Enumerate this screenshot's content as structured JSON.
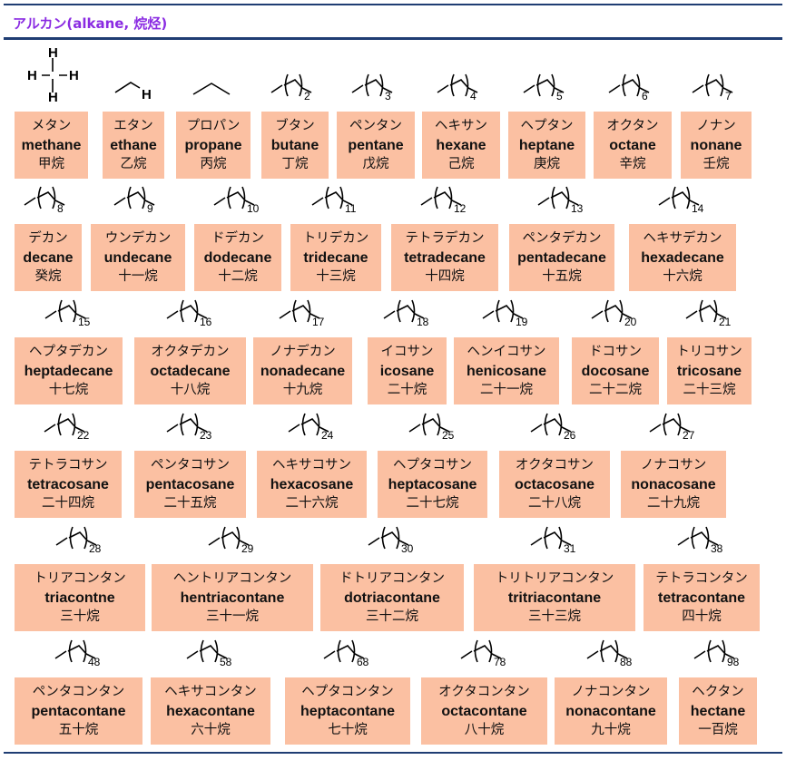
{
  "title": "アルカン(alkane, 烷烃)",
  "colors": {
    "title": "#8a2be2",
    "rule": "#1f3d73",
    "card": "#fbc0a2"
  },
  "alkanes": [
    {
      "kana": "メタン",
      "en": "methane",
      "kanji": "甲烷",
      "n": ""
    },
    {
      "kana": "エタン",
      "en": "ethane",
      "kanji": "乙烷",
      "n": ""
    },
    {
      "kana": "プロパン",
      "en": "propane",
      "kanji": "丙烷",
      "n": ""
    },
    {
      "kana": "ブタン",
      "en": "butane",
      "kanji": "丁烷",
      "n": "2"
    },
    {
      "kana": "ペンタン",
      "en": "pentane",
      "kanji": "戊烷",
      "n": "3"
    },
    {
      "kana": "ヘキサン",
      "en": "hexane",
      "kanji": "己烷",
      "n": "4"
    },
    {
      "kana": "ヘプタン",
      "en": "heptane",
      "kanji": "庚烷",
      "n": "5"
    },
    {
      "kana": "オクタン",
      "en": "octane",
      "kanji": "辛烷",
      "n": "6"
    },
    {
      "kana": "ノナン",
      "en": "nonane",
      "kanji": "壬烷",
      "n": "7"
    },
    {
      "kana": "デカン",
      "en": "decane",
      "kanji": "癸烷",
      "n": "8"
    },
    {
      "kana": "ウンデカン",
      "en": "undecane",
      "kanji": "十一烷",
      "n": "9"
    },
    {
      "kana": "ドデカン",
      "en": "dodecane",
      "kanji": "十二烷",
      "n": "10"
    },
    {
      "kana": "トリデカン",
      "en": "tridecane",
      "kanji": "十三烷",
      "n": "11"
    },
    {
      "kana": "テトラデカン",
      "en": "tetradecane",
      "kanji": "十四烷",
      "n": "12"
    },
    {
      "kana": "ペンタデカン",
      "en": "pentadecane",
      "kanji": "十五烷",
      "n": "13"
    },
    {
      "kana": "ヘキサデカン",
      "en": "hexadecane",
      "kanji": "十六烷",
      "n": "14"
    },
    {
      "kana": "ヘプタデカン",
      "en": "heptadecane",
      "kanji": "十七烷",
      "n": "15"
    },
    {
      "kana": "オクタデカン",
      "en": "octadecane",
      "kanji": "十八烷",
      "n": "16"
    },
    {
      "kana": "ノナデカン",
      "en": "nonadecane",
      "kanji": "十九烷",
      "n": "17"
    },
    {
      "kana": "イコサン",
      "en": "icosane",
      "kanji": "二十烷",
      "n": "18"
    },
    {
      "kana": "ヘンイコサン",
      "en": "henicosane",
      "kanji": "二十一烷",
      "n": "19"
    },
    {
      "kana": "ドコサン",
      "en": "docosane",
      "kanji": "二十二烷",
      "n": "20"
    },
    {
      "kana": "トリコサン",
      "en": "tricosane",
      "kanji": "二十三烷",
      "n": "21"
    },
    {
      "kana": "テトラコサン",
      "en": "tetracosane",
      "kanji": "二十四烷",
      "n": "22"
    },
    {
      "kana": "ペンタコサン",
      "en": "pentacosane",
      "kanji": "二十五烷",
      "n": "23"
    },
    {
      "kana": "ヘキサコサン",
      "en": "hexacosane",
      "kanji": "二十六烷",
      "n": "24"
    },
    {
      "kana": "ヘプタコサン",
      "en": "heptacosane",
      "kanji": "二十七烷",
      "n": "25"
    },
    {
      "kana": "オクタコサン",
      "en": "octacosane",
      "kanji": "二十八烷",
      "n": "26"
    },
    {
      "kana": "ノナコサン",
      "en": "nonacosane",
      "kanji": "二十九烷",
      "n": "27"
    },
    {
      "kana": "トリアコンタン",
      "en": "triacontne",
      "kanji": "三十烷",
      "n": "28"
    },
    {
      "kana": "ヘントリアコンタン",
      "en": "hentriacontane",
      "kanji": "三十一烷",
      "n": "29"
    },
    {
      "kana": "ドトリアコンタン",
      "en": "dotriacontane",
      "kanji": "三十二烷",
      "n": "30"
    },
    {
      "kana": "トリトリアコンタン",
      "en": "tritriacontane",
      "kanji": "三十三烷",
      "n": "31"
    },
    {
      "kana": "テトラコンタン",
      "en": "tetracontane",
      "kanji": "四十烷",
      "n": "38"
    },
    {
      "kana": "ペンタコンタン",
      "en": "pentacontane",
      "kanji": "五十烷",
      "n": "48"
    },
    {
      "kana": "ヘキサコンタン",
      "en": "hexacontane",
      "kanji": "六十烷",
      "n": "58"
    },
    {
      "kana": "ヘプタコンタン",
      "en": "heptacontane",
      "kanji": "七十烷",
      "n": "68"
    },
    {
      "kana": "オクタコンタン",
      "en": "octacontane",
      "kanji": "八十烷",
      "n": "78"
    },
    {
      "kana": "ノナコンタン",
      "en": "nonacontane",
      "kanji": "九十烷",
      "n": "88"
    },
    {
      "kana": "ヘクタン",
      "en": "hectane",
      "kanji": "一百烷",
      "n": "98"
    }
  ],
  "atom_labels": {
    "hydrogen": "H"
  }
}
